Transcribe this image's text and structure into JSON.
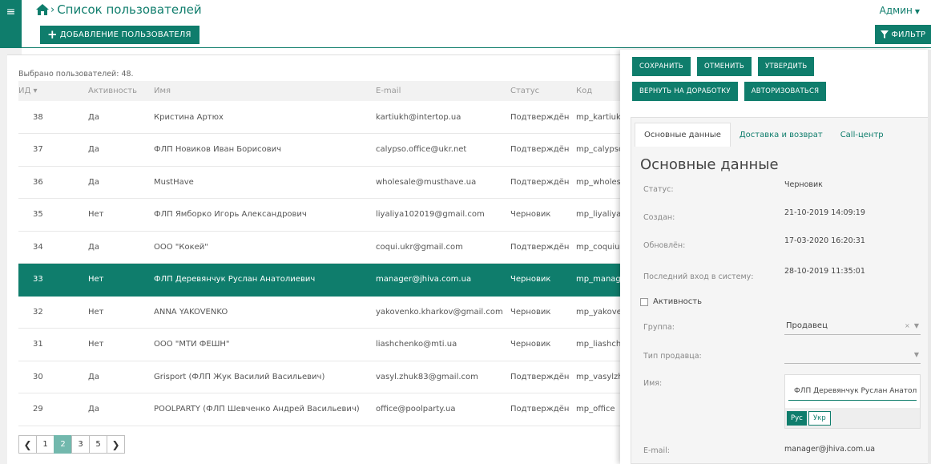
{
  "header": {
    "title": "Список пользователей",
    "add_button": "ДОБАВЛЕНИЕ ПОЛЬЗОВАТЕЛЯ",
    "user_menu": "Админ",
    "filter_button": "ФИЛЬТР"
  },
  "list": {
    "selected_count": "Выбрано пользователей: 48.",
    "columns": [
      "ИД ▾",
      "Активность",
      "Имя",
      "E-mail",
      "Статус",
      "Код"
    ],
    "rows": [
      {
        "id": "38",
        "active": "Да",
        "name": "Кристина Артюх",
        "email": "kartiukh@intertop.ua",
        "status": "Подтверждён",
        "code": "mp_kartiukh"
      },
      {
        "id": "37",
        "active": "Да",
        "name": "ФЛП Новиков Иван Борисович",
        "email": "calypso.office@ukr.net",
        "status": "Подтверждён",
        "code": "mp_calypso"
      },
      {
        "id": "36",
        "active": "Да",
        "name": "MustHave",
        "email": "wholesale@musthave.ua",
        "status": "Подтверждён",
        "code": "mp_wholesale"
      },
      {
        "id": "35",
        "active": "Нет",
        "name": "ФЛП Ямборко Игорь Александрович",
        "email": "liyaliya102019@gmail.com",
        "status": "Черновик",
        "code": "mp_liyaliya"
      },
      {
        "id": "34",
        "active": "Да",
        "name": "ООО \"Кокей\"",
        "email": "coqui.ukr@gmail.com",
        "status": "Подтверждён",
        "code": "mp_coquiukr"
      },
      {
        "id": "33",
        "active": "Нет",
        "name": "ФЛП Деревянчук Руслан Анатолиевич",
        "email": "manager@jhiva.com.ua",
        "status": "Черновик",
        "code": "mp_manager"
      },
      {
        "id": "32",
        "active": "Нет",
        "name": "ANNA YAKOVENKO",
        "email": "yakovenko.kharkov@gmail.com",
        "status": "Черновик",
        "code": "mp_yakovenko"
      },
      {
        "id": "31",
        "active": "Нет",
        "name": "ООО \"МТИ ФЕШН\"",
        "email": "liashchenko@mti.ua",
        "status": "Черновик",
        "code": "mp_liashchenko"
      },
      {
        "id": "30",
        "active": "Да",
        "name": "Grisport (ФЛП Жук Василий Васильевич)",
        "email": "vasyl.zhuk83@gmail.com",
        "status": "Подтверждён",
        "code": "mp_vasylzhuk"
      },
      {
        "id": "29",
        "active": "Да",
        "name": "POOLPARTY (ФЛП Шевченко Андрей Васильевич)",
        "email": "office@poolparty.ua",
        "status": "Подтверждён",
        "code": "mp_office"
      }
    ],
    "pagination": {
      "prev": "❮",
      "pages": [
        "1",
        "2",
        "3",
        "5"
      ],
      "current": "2",
      "next": "❯"
    }
  },
  "panel": {
    "actions": [
      "СОХРАНИТЬ",
      "ОТМЕНИТЬ",
      "УТВЕРДИТЬ",
      "ВЕРНУТЬ НА ДОРАБОТКУ",
      "АВТОРИЗОВАТЬСЯ"
    ],
    "tabs": [
      "Основные данные",
      "Доставка и возврат",
      "Call-центр"
    ],
    "section_title": "Основные данные",
    "status_label": "Статус:",
    "status_value": "Черновик",
    "created_label": "Создан:",
    "created_value": "21-10-2019 14:09:19",
    "updated_label": "Обновлён:",
    "updated_value": "17-03-2020 16:20:31",
    "last_login_label": "Последний вход в систему:",
    "last_login_value": "28-10-2019 11:35:01",
    "active_label": "Активность",
    "group_label": "Группа:",
    "group_value": "Продавец",
    "seller_type_label": "Тип продавца:",
    "seller_type_value": "",
    "name_label": "Имя:",
    "name_value": "ФЛП Деревянчук Руслан Анатолиевич",
    "lang_ru": "Рус",
    "lang_uk": "Укр",
    "email_label": "E-mail:",
    "email_value": "manager@jhiva.com.ua"
  },
  "colors": {
    "accent": "#0f7d6c",
    "page_current": "#72b8ad"
  }
}
